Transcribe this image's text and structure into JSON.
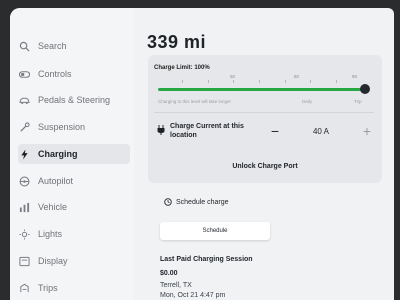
{
  "range": "339 mi",
  "sidebar": {
    "items": [
      {
        "label": "Search",
        "icon": "search-icon"
      },
      {
        "label": "Controls",
        "icon": "toggle-icon"
      },
      {
        "label": "Pedals & Steering",
        "icon": "car-icon"
      },
      {
        "label": "Suspension",
        "icon": "wrench-icon"
      },
      {
        "label": "Charging",
        "icon": "bolt-icon",
        "active": true
      },
      {
        "label": "Autopilot",
        "icon": "steering-wheel-icon"
      },
      {
        "label": "Vehicle",
        "icon": "bars-icon"
      },
      {
        "label": "Lights",
        "icon": "sun-icon"
      },
      {
        "label": "Display",
        "icon": "display-icon"
      },
      {
        "label": "Trips",
        "icon": "trips-icon"
      }
    ]
  },
  "charge": {
    "limit_label": "Charge Limit: 100%",
    "limit_value": 100,
    "scale_labels": [
      "50",
      "80",
      "90"
    ],
    "sub_left": "Charging to this level will take longer",
    "sub_mid": "Daily",
    "sub_right": "Trip",
    "current_label": "Charge Current at this location",
    "current_value": "40 A",
    "minus": "−",
    "plus": "+",
    "unlock": "Unlock Charge Port"
  },
  "schedule": {
    "heading": "Schedule charge",
    "button": "Schedule"
  },
  "session": {
    "title": "Last Paid Charging Session",
    "amount": "$0.00",
    "location": "Terrell, TX",
    "date": "Mon, Oct 21 4:47 pm"
  },
  "colors": {
    "accent_green": "#27a844",
    "background": "#f1f2f4",
    "card": "#e6e7ea"
  }
}
